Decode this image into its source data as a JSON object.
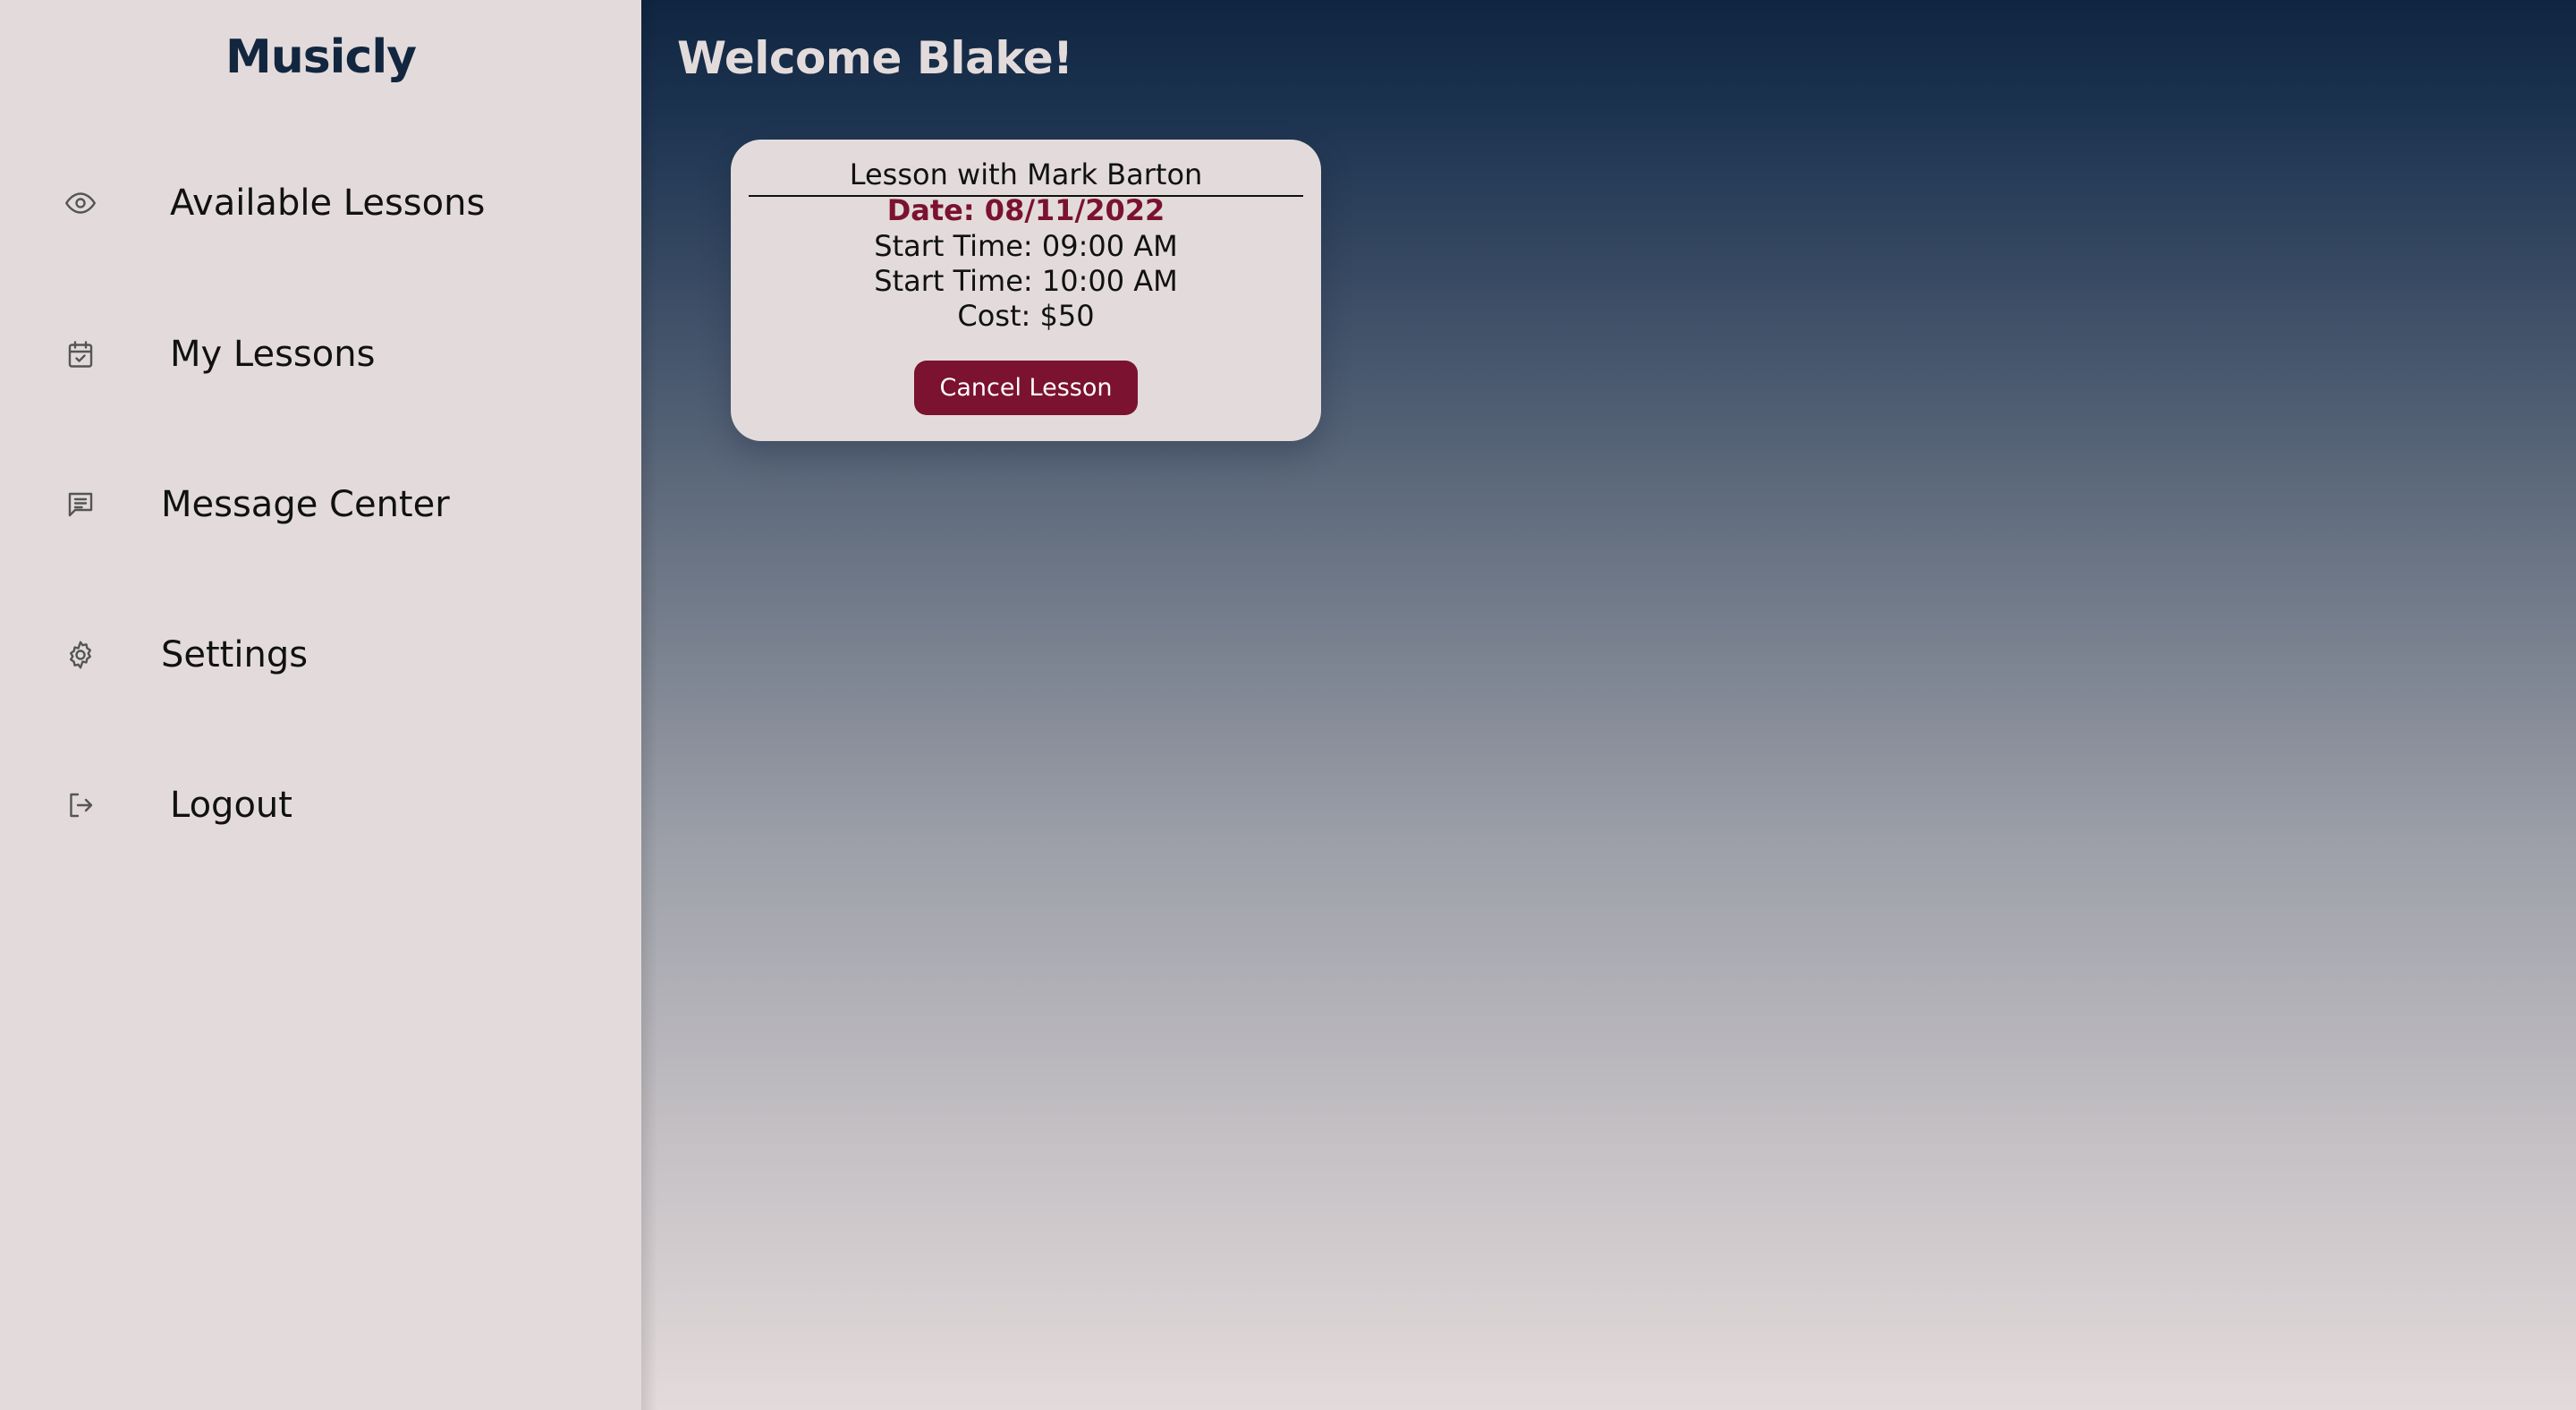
{
  "sidebar": {
    "brand": "Musicly",
    "items": [
      {
        "label": "Available Lessons",
        "icon": "eye-icon"
      },
      {
        "label": "My Lessons",
        "icon": "calendar-check-icon"
      },
      {
        "label": "Message Center",
        "icon": "message-icon"
      },
      {
        "label": "Settings",
        "icon": "gear-icon"
      },
      {
        "label": "Logout",
        "icon": "logout-icon"
      }
    ]
  },
  "main": {
    "welcome": "Welcome Blake!",
    "lesson": {
      "title": "Lesson with Mark Barton",
      "date": "Date: 08/11/2022",
      "start_time": "Start Time: 09:00 AM",
      "end_time": "Start Time: 10:00 AM",
      "cost": "Cost: $50",
      "cancel_label": "Cancel Lesson"
    }
  },
  "colors": {
    "sidebar_bg": "#e3dbdb",
    "brand": "#12263f",
    "accent": "#7a1230",
    "gradient_top": "#0f2540",
    "gradient_bottom": "#e3dbdb"
  }
}
